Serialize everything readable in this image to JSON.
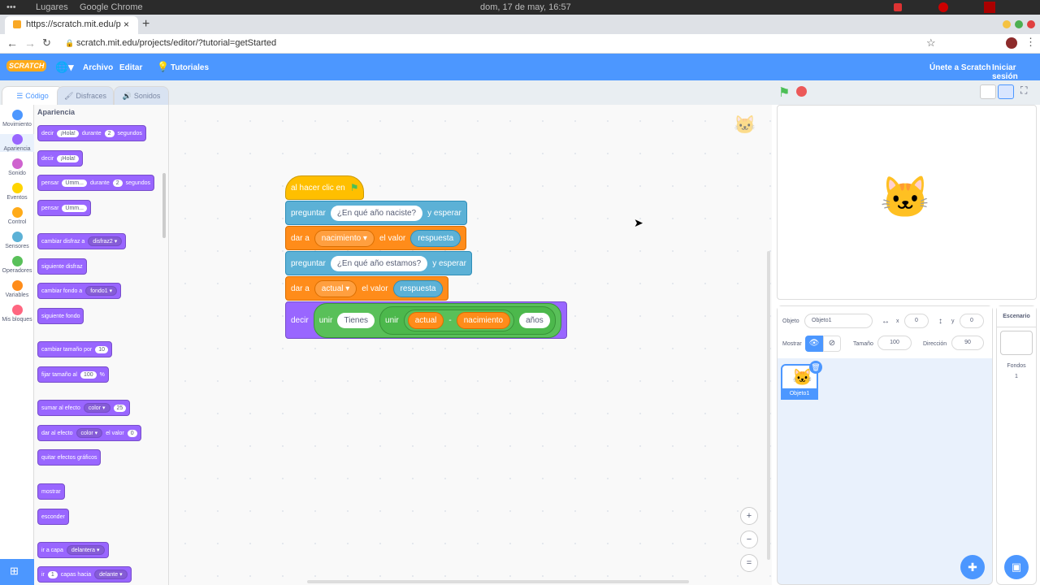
{
  "os": {
    "menu": "Lugares",
    "app": "Google Chrome",
    "clock": "dom, 17 de may, 16:57"
  },
  "browser": {
    "tab_title": "https://scratch.mit.edu/p",
    "url": "scratch.mit.edu/projects/editor/?tutorial=getStarted",
    "new_tab": "+"
  },
  "menubar": {
    "logo": "SCRATCH",
    "file": "Archivo",
    "edit": "Editar",
    "tutorials": "Tutoriales",
    "join": "Únete a Scratch",
    "signin": "Iniciar sesión"
  },
  "tabs": {
    "code": "Código",
    "costumes": "Disfraces",
    "sounds": "Sonidos"
  },
  "categories": [
    {
      "label": "Movimiento",
      "color": "#4c97ff"
    },
    {
      "label": "Apariencia",
      "color": "#9966ff"
    },
    {
      "label": "Sonido",
      "color": "#cf63cf"
    },
    {
      "label": "Eventos",
      "color": "#ffd500"
    },
    {
      "label": "Control",
      "color": "#ffab19"
    },
    {
      "label": "Sensores",
      "color": "#5cb1d6"
    },
    {
      "label": "Operadores",
      "color": "#59c059"
    },
    {
      "label": "Variables",
      "color": "#ff8c1a"
    },
    {
      "label": "Mis bloques",
      "color": "#ff6680"
    }
  ],
  "palette": {
    "title": "Apariencia",
    "say_for": {
      "a": "decir",
      "b": "¡Hola!",
      "c": "durante",
      "d": "2",
      "e": "segundos"
    },
    "say": {
      "a": "decir",
      "b": "¡Hola!"
    },
    "think_for": {
      "a": "pensar",
      "b": "Umm...",
      "c": "durante",
      "d": "2",
      "e": "segundos"
    },
    "think": {
      "a": "pensar",
      "b": "Umm..."
    },
    "switch_costume": {
      "a": "cambiar disfraz a",
      "b": "disfraz2"
    },
    "next_costume": "siguiente disfraz",
    "switch_backdrop": {
      "a": "cambiar fondo a",
      "b": "fondo1"
    },
    "next_backdrop": "siguiente fondo",
    "change_size": {
      "a": "cambiar tamaño por",
      "b": "10"
    },
    "set_size": {
      "a": "fijar tamaño al",
      "b": "100",
      "c": "%"
    },
    "change_effect": {
      "a": "sumar al efecto",
      "b": "color",
      "c": "25"
    },
    "set_effect": {
      "a": "dar al efecto",
      "b": "color",
      "c": "el valor",
      "d": "0"
    },
    "clear_effects": "quitar efectos gráficos",
    "show": "mostrar",
    "hide": "esconder",
    "go_layer": {
      "a": "ir a capa",
      "b": "delantera"
    },
    "go_layers": {
      "a": "ir",
      "b": "1",
      "c": "capas hacia",
      "d": "delante"
    }
  },
  "script": {
    "hat": "al hacer clic en",
    "ask1": {
      "a": "preguntar",
      "b": "¿En qué año naciste?",
      "c": "y esperar"
    },
    "set1": {
      "a": "dar a",
      "b": "nacimiento",
      "c": "el valor",
      "d": "respuesta"
    },
    "ask2": {
      "a": "preguntar",
      "b": "¿En qué año estamos?",
      "c": "y esperar"
    },
    "set2": {
      "a": "dar a",
      "b": "actual",
      "c": "el valor",
      "d": "respuesta"
    },
    "say": {
      "a": "decir",
      "b": "unir",
      "c": "Tienes",
      "d": "unir",
      "e": "actual",
      "f": "-",
      "g": "nacimiento",
      "h": "años"
    }
  },
  "sprite_info": {
    "sprite_label": "Objeto",
    "sprite_name": "Objeto1",
    "x_label": "x",
    "x": "0",
    "y_label": "y",
    "y": "0",
    "show_label": "Mostrar",
    "size_label": "Tamaño",
    "size": "100",
    "direction_label": "Dirección",
    "direction": "90"
  },
  "sprites": [
    {
      "name": "Objeto1"
    }
  ],
  "backdrop": {
    "title": "Escenario",
    "label": "Fondos",
    "count": "1"
  },
  "zoom": {
    "in": "+",
    "out": "−",
    "reset": "="
  }
}
